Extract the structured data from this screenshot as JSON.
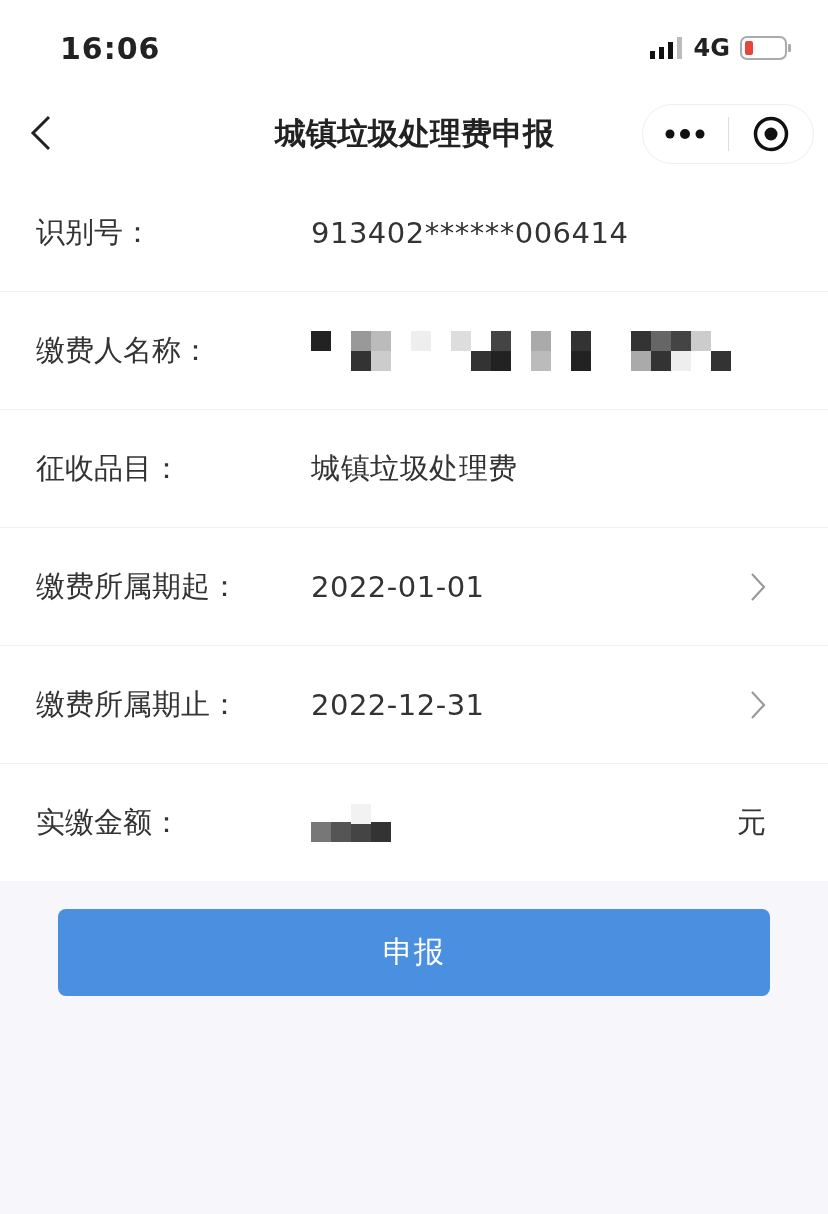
{
  "status_bar": {
    "time": "16:06",
    "network": "4G"
  },
  "nav": {
    "title": "城镇垃圾处理费申报"
  },
  "fields": [
    {
      "label": "识别号：",
      "value": "913402******006414",
      "kind": "text"
    },
    {
      "label": "缴费人名称：",
      "kind": "redacted"
    },
    {
      "label": "征收品目：",
      "value": "城镇垃圾处理费",
      "kind": "text"
    },
    {
      "label": "缴费所属期起：",
      "value": "2022-01-01",
      "kind": "picker"
    },
    {
      "label": "缴费所属期止：",
      "value": "2022-12-31",
      "kind": "picker"
    },
    {
      "label": "实缴金额：",
      "kind": "amount",
      "unit": "元"
    }
  ],
  "submit_button": "申报"
}
